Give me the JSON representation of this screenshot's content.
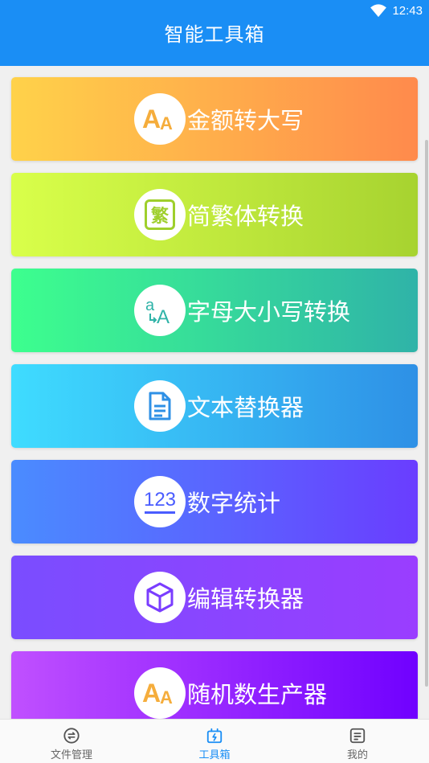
{
  "status_bar": {
    "time": "12:43"
  },
  "app_bar": {
    "title": "智能工具箱"
  },
  "tools": [
    {
      "label": "金额转大写",
      "icon": "font-aa-icon"
    },
    {
      "label": "简繁体转换",
      "icon": "traditional-char-icon",
      "icon_text": "繁"
    },
    {
      "label": "字母大小写转换",
      "icon": "letter-case-icon"
    },
    {
      "label": "文本替换器",
      "icon": "document-icon"
    },
    {
      "label": "数字统计",
      "icon": "number-123-icon",
      "icon_text": "123"
    },
    {
      "label": "编辑转换器",
      "icon": "cube-icon"
    },
    {
      "label": "随机数生产器",
      "icon": "font-aa-icon"
    }
  ],
  "bottom_nav": {
    "items": [
      {
        "label": "文件管理",
        "icon": "file-manage-icon",
        "active": false
      },
      {
        "label": "工具箱",
        "icon": "toolbox-icon",
        "active": true
      },
      {
        "label": "我的",
        "icon": "profile-icon",
        "active": false
      }
    ]
  },
  "colors": {
    "primary": "#1a8ef5",
    "card_gradients": [
      [
        "#ffd24a",
        "#ff8a4c"
      ],
      [
        "#d9ff4a",
        "#a7d330"
      ],
      [
        "#3dff8e",
        "#2fb3a8"
      ],
      [
        "#3fdcff",
        "#2e90e6"
      ],
      [
        "#4a8cff",
        "#6a3dff"
      ],
      [
        "#7a4dff",
        "#9a3dff"
      ],
      [
        "#c050ff",
        "#7000ff"
      ]
    ]
  }
}
